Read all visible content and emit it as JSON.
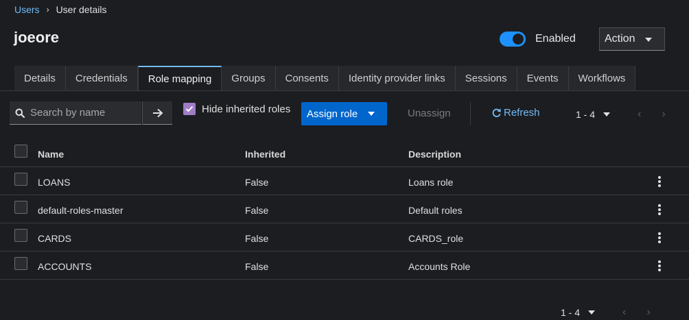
{
  "breadcrumb": {
    "parent": "Users",
    "separator": "›",
    "current": "User details"
  },
  "page": {
    "title": "joeore"
  },
  "header": {
    "enabled_label": "Enabled",
    "action_label": "Action"
  },
  "tabs": [
    {
      "label": "Details"
    },
    {
      "label": "Credentials"
    },
    {
      "label": "Role mapping",
      "active": true
    },
    {
      "label": "Groups"
    },
    {
      "label": "Consents"
    },
    {
      "label": "Identity provider links"
    },
    {
      "label": "Sessions"
    },
    {
      "label": "Events"
    },
    {
      "label": "Workflows"
    }
  ],
  "toolbar": {
    "search_placeholder": "Search by name",
    "hide_inherited_label": "Hide inherited roles",
    "assign_label": "Assign role",
    "unassign_label": "Unassign",
    "refresh_label": "Refresh",
    "pager_range": "1 - 4"
  },
  "table": {
    "columns": [
      "Name",
      "Inherited",
      "Description"
    ],
    "rows": [
      {
        "name": "LOANS",
        "inherited": "False",
        "description": "Loans role"
      },
      {
        "name": "default-roles-master",
        "inherited": "False",
        "description": "Default roles"
      },
      {
        "name": "CARDS",
        "inherited": "False",
        "description": "CARDS_role"
      },
      {
        "name": "ACCOUNTS",
        "inherited": "False",
        "description": "Accounts Role"
      }
    ]
  },
  "footer": {
    "pager_range": "1 - 4"
  },
  "colors": {
    "accent": "#73bcf7",
    "primary": "#0066cc",
    "toggle_on": "#1e90ff",
    "checkbox_checked": "#a07cc5",
    "background": "#1b1d21"
  }
}
